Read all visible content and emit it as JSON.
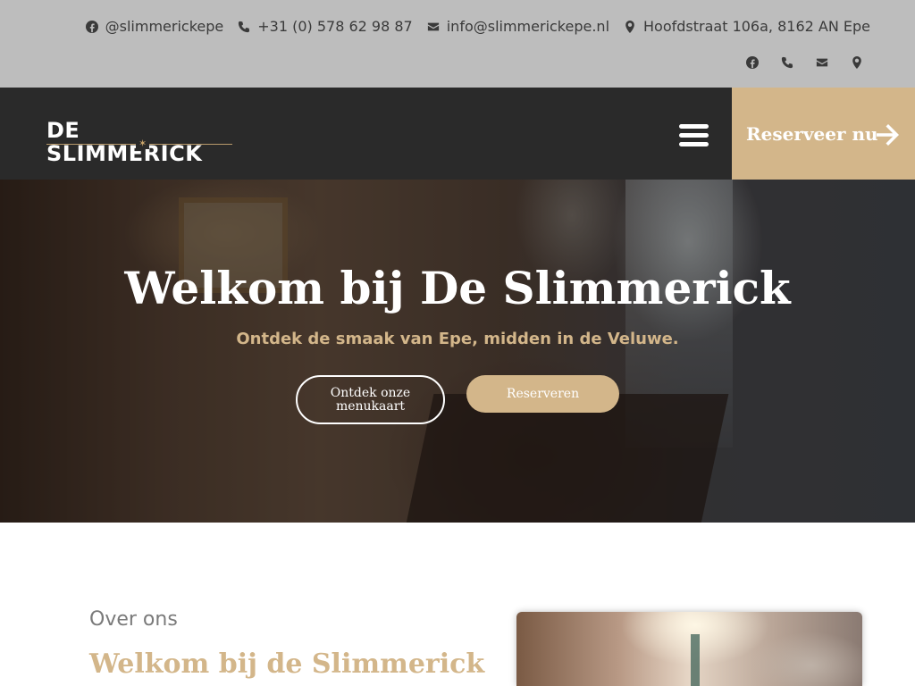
{
  "topbar": {
    "facebook": "@slimmerickepe",
    "phone": "+31 (0) 578 62 98 87",
    "email": "info@slimmerickepe.nl",
    "address": "Hoofdstraat 106a, 8162 AN Epe",
    "icon_row": [
      "facebook-icon",
      "phone-icon",
      "envelope-icon",
      "map-pin-icon"
    ]
  },
  "header": {
    "logo_text": "DE SLIMMERICK",
    "reserve_label": "Reserveer nu"
  },
  "hero": {
    "title": "Welkom bij De Slimmerick",
    "subtitle": "Ontdek de smaak van Epe, midden in de Veluwe.",
    "menu_button": "Ontdek onze menukaart",
    "reserve_button": "Reserveren"
  },
  "about": {
    "kicker": "Over ons",
    "title": "Welkom bij de Slimmerick"
  },
  "colors": {
    "accent_gold": "#d3b68a",
    "topbar_gray": "#bdbdbd",
    "header_dark": "#2a2a2a"
  }
}
